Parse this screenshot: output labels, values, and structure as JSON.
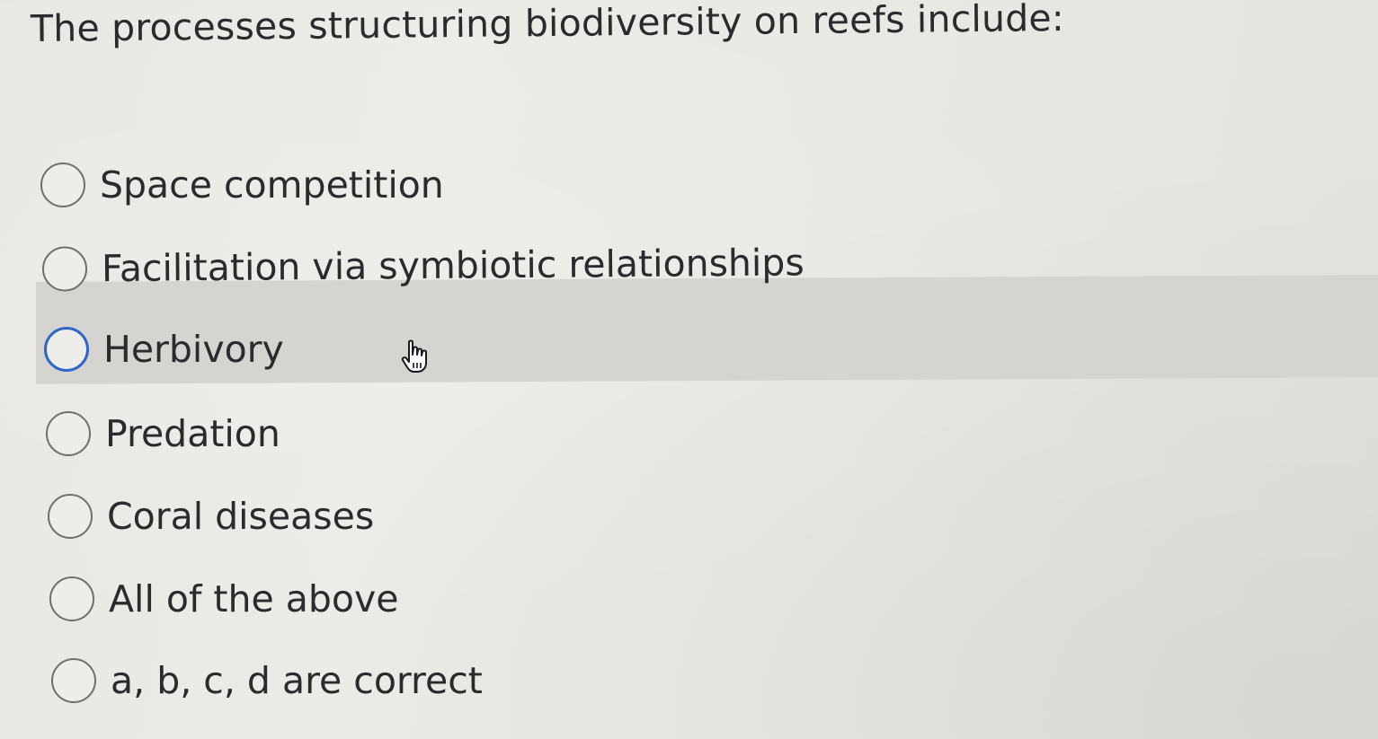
{
  "question": {
    "text": "The processes structuring biodiversity on reefs include:"
  },
  "options": [
    {
      "label": "Space competition",
      "selected": false,
      "hovered": false
    },
    {
      "label": "Facilitation via symbiotic relationships",
      "selected": false,
      "hovered": false
    },
    {
      "label": "Herbivory",
      "selected": false,
      "hovered": true
    },
    {
      "label": "Predation",
      "selected": false,
      "hovered": false
    },
    {
      "label": "Coral diseases",
      "selected": false,
      "hovered": false
    },
    {
      "label": "All of the above",
      "selected": false,
      "hovered": false
    },
    {
      "label": "a, b, c, d are correct",
      "selected": false,
      "hovered": false
    }
  ],
  "cursor": {
    "icon": "hand-pointer-icon"
  },
  "colors": {
    "background": "#e9e8e4",
    "hover_band": "#d5d4d1",
    "radio_border": "#6f6f6f",
    "radio_hover_border": "#2f66c8",
    "text": "#2b2b2b"
  }
}
